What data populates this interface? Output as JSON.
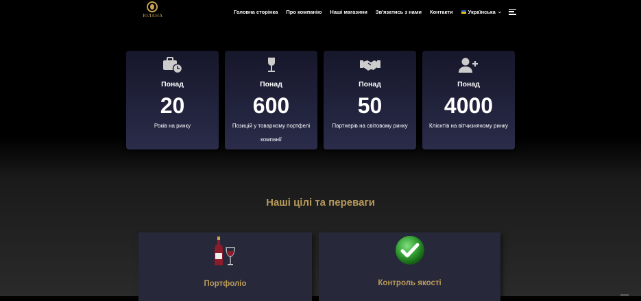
{
  "logo": {
    "wordmark": "ЮЛАНА"
  },
  "nav": {
    "items": [
      "Головна сторінка",
      "Про компанію",
      "Наші магазини",
      "Зв'язатись з нами",
      "Контакти"
    ],
    "language": "Українська"
  },
  "stats": [
    {
      "icon": "briefcase-clock-icon",
      "prefix": "Понад",
      "number": "20",
      "desc": "Років на ринку"
    },
    {
      "icon": "wine-glass-icon",
      "prefix": "Понад",
      "number": "600",
      "desc": "Позицій у товарному портфелі компанії"
    },
    {
      "icon": "handshake-icon",
      "prefix": "Понад",
      "number": "50",
      "desc": "Партнерів на світовому ринку"
    },
    {
      "icon": "add-user-icon",
      "prefix": "Понад",
      "number": "4000",
      "desc": "Клієнтів на вітчизняному ринку"
    }
  ],
  "goals": {
    "title": "Наші цілі та переваги",
    "cards": [
      {
        "icon": "wine-bottle-glass-icon",
        "title": "Портфоліо"
      },
      {
        "icon": "green-check-icon",
        "title": "Контроль якості"
      }
    ]
  },
  "colors": {
    "accent": "#b89a5b",
    "card_bg": "#2a2c4a",
    "check": "#2e9a2e"
  }
}
